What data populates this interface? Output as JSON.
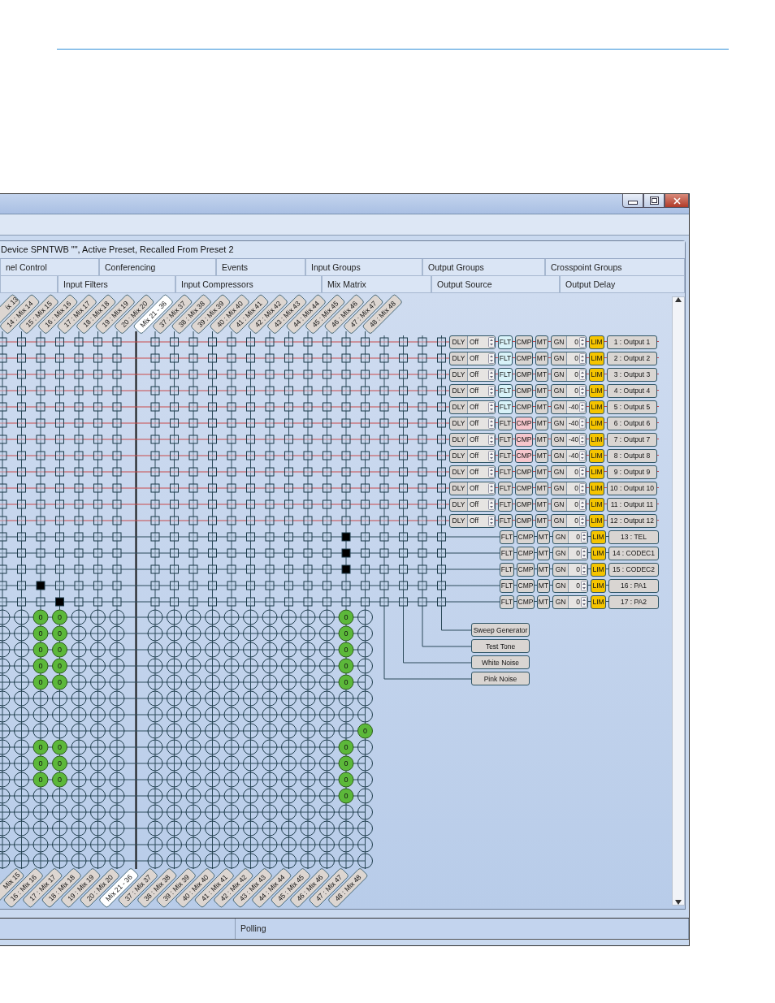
{
  "window": {
    "header": "Device SPNTWB \"\", Active Preset, Recalled From Preset 2"
  },
  "tabs_row_1": [
    {
      "label": "nel Control"
    },
    {
      "label": "Conferencing"
    },
    {
      "label": "Events"
    },
    {
      "label": "Input Groups"
    },
    {
      "label": "Output Groups"
    },
    {
      "label": "Crosspoint Groups"
    }
  ],
  "tabs_row_2": [
    {
      "label": "Input Filters"
    },
    {
      "label": "Input Compressors"
    },
    {
      "label": "Mix Matrix"
    },
    {
      "label": "Output Source"
    },
    {
      "label": "Output Delay"
    }
  ],
  "matrix": {
    "top_labels": [
      {
        "text": "ix 13",
        "kind": "partial"
      },
      {
        "text": "14 : Mix 14",
        "kind": "mix"
      },
      {
        "text": "15 : Mix 15",
        "kind": "mix"
      },
      {
        "text": "16 : Mix 16",
        "kind": "mix"
      },
      {
        "text": "17 : Mix 17",
        "kind": "mix"
      },
      {
        "text": "18 : Mix 18",
        "kind": "mix"
      },
      {
        "text": "19 : Mix 19",
        "kind": "mix"
      },
      {
        "text": "20 : Mix 20",
        "kind": "mix"
      },
      {
        "text": "Mix 21 - 36",
        "kind": "group"
      },
      {
        "text": "37 : Mix 37",
        "kind": "mix"
      },
      {
        "text": "38 : Mix 38",
        "kind": "mix"
      },
      {
        "text": "39 : Mix 39",
        "kind": "mix"
      },
      {
        "text": "40 : Mix 40",
        "kind": "mix"
      },
      {
        "text": "41 : Mix 41",
        "kind": "mix"
      },
      {
        "text": "42 : Mix 42",
        "kind": "mix"
      },
      {
        "text": "43 : Mix 43",
        "kind": "mix"
      },
      {
        "text": "44 : Mix 44",
        "kind": "mix"
      },
      {
        "text": "45 : Mix 45",
        "kind": "mix"
      },
      {
        "text": "46 : Mix 46",
        "kind": "mix"
      },
      {
        "text": "47 : Mix 47",
        "kind": "mix"
      },
      {
        "text": "48 : Mix 48",
        "kind": "mix"
      }
    ],
    "bottom_labels": [
      {
        "text": "Mix 15",
        "kind": "partial"
      },
      {
        "text": "16 : Mix 16",
        "kind": "mix"
      },
      {
        "text": "17 : Mix 17",
        "kind": "mix"
      },
      {
        "text": "18 : Mix 18",
        "kind": "mix"
      },
      {
        "text": "19 : Mix 19",
        "kind": "mix"
      },
      {
        "text": "20 : Mix 20",
        "kind": "mix"
      },
      {
        "text": "Mix 21 - 36",
        "kind": "group"
      },
      {
        "text": "37 : Mix 37",
        "kind": "mix"
      },
      {
        "text": "38 : Mix 38",
        "kind": "mix"
      },
      {
        "text": "39 : Mix 39",
        "kind": "mix"
      },
      {
        "text": "40 : Mix 40",
        "kind": "mix"
      },
      {
        "text": "41 : Mix 41",
        "kind": "mix"
      },
      {
        "text": "42 : Mix 42",
        "kind": "mix"
      },
      {
        "text": "43 : Mix 43",
        "kind": "mix"
      },
      {
        "text": "44 : Mix 44",
        "kind": "mix"
      },
      {
        "text": "45 : Mix 45",
        "kind": "mix"
      },
      {
        "text": "46 : Mix 46",
        "kind": "mix"
      },
      {
        "text": "47 : Mix 47",
        "kind": "mix"
      },
      {
        "text": "48 : Mix 48",
        "kind": "mix"
      }
    ],
    "columns": [
      {
        "kind": "mix"
      },
      {
        "kind": "mix"
      },
      {
        "kind": "mix"
      },
      {
        "kind": "mix"
      },
      {
        "kind": "mix"
      },
      {
        "kind": "mix"
      },
      {
        "kind": "mix"
      },
      {
        "kind": "group"
      },
      {
        "kind": "mix"
      },
      {
        "kind": "mix"
      },
      {
        "kind": "mix"
      },
      {
        "kind": "mix"
      },
      {
        "kind": "mix"
      },
      {
        "kind": "mix"
      },
      {
        "kind": "mix"
      },
      {
        "kind": "mix"
      },
      {
        "kind": "mix"
      },
      {
        "kind": "mix"
      },
      {
        "kind": "mix"
      },
      {
        "kind": "mix"
      },
      {
        "kind": "source"
      },
      {
        "kind": "source"
      },
      {
        "kind": "source"
      },
      {
        "kind": "source"
      }
    ],
    "rows": [
      {
        "name": "1 : Output 1",
        "delay": {
          "label": "DLY",
          "value": "Off"
        },
        "filter": {
          "label": "FLT",
          "on": true
        },
        "compressor": {
          "label": "CMP",
          "on": false
        },
        "mute": {
          "label": "MT"
        },
        "gain": {
          "label": "GN",
          "value": "0"
        },
        "limiter": {
          "label": "LIM"
        },
        "points": [
          false,
          false,
          false,
          false,
          false,
          false,
          false,
          false,
          false,
          false,
          false,
          false,
          false,
          false,
          false,
          false,
          false,
          false,
          false,
          false,
          false,
          false,
          false
        ]
      },
      {
        "name": "2 : Output 2",
        "delay": {
          "label": "DLY",
          "value": "Off"
        },
        "filter": {
          "label": "FLT",
          "on": true
        },
        "compressor": {
          "label": "CMP",
          "on": false
        },
        "mute": {
          "label": "MT"
        },
        "gain": {
          "label": "GN",
          "value": "0"
        },
        "limiter": {
          "label": "LIM"
        },
        "points": [
          false,
          false,
          false,
          false,
          false,
          false,
          false,
          false,
          false,
          false,
          false,
          false,
          false,
          false,
          false,
          false,
          false,
          false,
          false,
          false,
          false,
          false,
          false
        ]
      },
      {
        "name": "3 : Output 3",
        "delay": {
          "label": "DLY",
          "value": "Off"
        },
        "filter": {
          "label": "FLT",
          "on": true
        },
        "compressor": {
          "label": "CMP",
          "on": false
        },
        "mute": {
          "label": "MT"
        },
        "gain": {
          "label": "GN",
          "value": "0"
        },
        "limiter": {
          "label": "LIM"
        },
        "points": [
          false,
          false,
          false,
          false,
          false,
          false,
          false,
          false,
          false,
          false,
          false,
          false,
          false,
          false,
          false,
          false,
          false,
          false,
          false,
          false,
          false,
          false,
          false
        ]
      },
      {
        "name": "4 : Output 4",
        "delay": {
          "label": "DLY",
          "value": "Off"
        },
        "filter": {
          "label": "FLT",
          "on": true
        },
        "compressor": {
          "label": "CMP",
          "on": false
        },
        "mute": {
          "label": "MT"
        },
        "gain": {
          "label": "GN",
          "value": "0"
        },
        "limiter": {
          "label": "LIM"
        },
        "points": [
          false,
          false,
          false,
          false,
          false,
          false,
          false,
          false,
          false,
          false,
          false,
          false,
          false,
          false,
          false,
          false,
          false,
          false,
          false,
          false,
          false,
          false,
          false
        ]
      },
      {
        "name": "5 : Output 5",
        "delay": {
          "label": "DLY",
          "value": "Off"
        },
        "filter": {
          "label": "FLT",
          "on": true
        },
        "compressor": {
          "label": "CMP",
          "on": false
        },
        "mute": {
          "label": "MT"
        },
        "gain": {
          "label": "GN",
          "value": "-40"
        },
        "limiter": {
          "label": "LIM"
        },
        "points": [
          false,
          false,
          false,
          false,
          false,
          false,
          false,
          false,
          false,
          false,
          false,
          false,
          false,
          false,
          false,
          false,
          false,
          false,
          false,
          false,
          false,
          false,
          false
        ]
      },
      {
        "name": "6 : Output 6",
        "delay": {
          "label": "DLY",
          "value": "Off"
        },
        "filter": {
          "label": "FLT",
          "on": false
        },
        "compressor": {
          "label": "CMP",
          "on": true
        },
        "mute": {
          "label": "MT"
        },
        "gain": {
          "label": "GN",
          "value": "-40"
        },
        "limiter": {
          "label": "LIM"
        },
        "points": [
          false,
          false,
          false,
          false,
          false,
          false,
          false,
          false,
          false,
          false,
          false,
          false,
          false,
          false,
          false,
          false,
          false,
          false,
          false,
          false,
          false,
          false,
          false
        ]
      },
      {
        "name": "7 : Output 7",
        "delay": {
          "label": "DLY",
          "value": "Off"
        },
        "filter": {
          "label": "FLT",
          "on": false
        },
        "compressor": {
          "label": "CMP",
          "on": true
        },
        "mute": {
          "label": "MT"
        },
        "gain": {
          "label": "GN",
          "value": "-40"
        },
        "limiter": {
          "label": "LIM"
        },
        "points": [
          false,
          false,
          false,
          false,
          false,
          false,
          false,
          false,
          false,
          false,
          false,
          false,
          false,
          false,
          false,
          false,
          false,
          false,
          false,
          false,
          false,
          false,
          false
        ]
      },
      {
        "name": "8 : Output 8",
        "delay": {
          "label": "DLY",
          "value": "Off"
        },
        "filter": {
          "label": "FLT",
          "on": false
        },
        "compressor": {
          "label": "CMP",
          "on": true
        },
        "mute": {
          "label": "MT"
        },
        "gain": {
          "label": "GN",
          "value": "-40"
        },
        "limiter": {
          "label": "LIM"
        },
        "points": [
          false,
          false,
          false,
          false,
          false,
          false,
          false,
          false,
          false,
          false,
          false,
          false,
          false,
          false,
          false,
          false,
          false,
          false,
          false,
          false,
          false,
          false,
          false
        ]
      },
      {
        "name": "9 : Output 9",
        "delay": {
          "label": "DLY",
          "value": "Off"
        },
        "filter": {
          "label": "FLT",
          "on": false
        },
        "compressor": {
          "label": "CMP",
          "on": false
        },
        "mute": {
          "label": "MT"
        },
        "gain": {
          "label": "GN",
          "value": "0"
        },
        "limiter": {
          "label": "LIM"
        },
        "points": [
          false,
          false,
          false,
          false,
          false,
          false,
          false,
          false,
          false,
          false,
          false,
          false,
          false,
          false,
          false,
          false,
          false,
          false,
          false,
          false,
          false,
          false,
          false
        ]
      },
      {
        "name": "10 : Output 10",
        "delay": {
          "label": "DLY",
          "value": "Off"
        },
        "filter": {
          "label": "FLT",
          "on": false
        },
        "compressor": {
          "label": "CMP",
          "on": false
        },
        "mute": {
          "label": "MT"
        },
        "gain": {
          "label": "GN",
          "value": "0"
        },
        "limiter": {
          "label": "LIM"
        },
        "points": [
          false,
          false,
          false,
          false,
          false,
          false,
          false,
          false,
          false,
          false,
          false,
          false,
          false,
          false,
          false,
          false,
          false,
          false,
          false,
          false,
          false,
          false,
          false
        ]
      },
      {
        "name": "11 : Output 11",
        "delay": {
          "label": "DLY",
          "value": "Off"
        },
        "filter": {
          "label": "FLT",
          "on": false
        },
        "compressor": {
          "label": "CMP",
          "on": false
        },
        "mute": {
          "label": "MT"
        },
        "gain": {
          "label": "GN",
          "value": "0"
        },
        "limiter": {
          "label": "LIM"
        },
        "points": [
          false,
          false,
          false,
          false,
          false,
          false,
          false,
          false,
          false,
          false,
          false,
          false,
          false,
          false,
          false,
          false,
          false,
          false,
          false,
          false,
          false,
          false,
          false
        ]
      },
      {
        "name": "12 : Output 12",
        "delay": {
          "label": "DLY",
          "value": "Off"
        },
        "filter": {
          "label": "FLT",
          "on": false
        },
        "compressor": {
          "label": "CMP",
          "on": false
        },
        "mute": {
          "label": "MT"
        },
        "gain": {
          "label": "GN",
          "value": "0"
        },
        "limiter": {
          "label": "LIM"
        },
        "points": [
          false,
          false,
          false,
          false,
          false,
          false,
          false,
          false,
          false,
          false,
          false,
          false,
          false,
          false,
          false,
          false,
          false,
          false,
          false,
          false,
          false,
          false,
          false
        ]
      },
      {
        "name": "13 : TEL",
        "filter": {
          "label": "FLT",
          "on": false
        },
        "compressor": {
          "label": "CMP",
          "on": false
        },
        "mute": {
          "label": "MT"
        },
        "gain": {
          "label": "GN",
          "value": "0"
        },
        "limiter": {
          "label": "LIM"
        },
        "points": [
          false,
          false,
          false,
          false,
          false,
          false,
          false,
          false,
          false,
          false,
          false,
          false,
          false,
          false,
          false,
          false,
          false,
          true,
          false,
          false,
          false,
          false,
          false
        ]
      },
      {
        "name": "14 : CODEC1",
        "filter": {
          "label": "FLT",
          "on": false
        },
        "compressor": {
          "label": "CMP",
          "on": false
        },
        "mute": {
          "label": "MT"
        },
        "gain": {
          "label": "GN",
          "value": "0"
        },
        "limiter": {
          "label": "LIM"
        },
        "points": [
          false,
          false,
          false,
          false,
          false,
          false,
          false,
          false,
          false,
          false,
          false,
          false,
          false,
          false,
          false,
          false,
          false,
          true,
          false,
          false,
          false,
          false,
          false
        ]
      },
      {
        "name": "15 : CODEC2",
        "filter": {
          "label": "FLT",
          "on": false
        },
        "compressor": {
          "label": "CMP",
          "on": false
        },
        "mute": {
          "label": "MT"
        },
        "gain": {
          "label": "GN",
          "value": "0"
        },
        "limiter": {
          "label": "LIM"
        },
        "points": [
          false,
          false,
          false,
          false,
          false,
          false,
          false,
          false,
          false,
          false,
          false,
          false,
          false,
          false,
          false,
          false,
          false,
          true,
          false,
          false,
          false,
          false,
          false
        ]
      },
      {
        "name": "16 : PA1",
        "filter": {
          "label": "FLT",
          "on": false
        },
        "compressor": {
          "label": "CMP",
          "on": false
        },
        "mute": {
          "label": "MT"
        },
        "gain": {
          "label": "GN",
          "value": "0"
        },
        "limiter": {
          "label": "LIM"
        },
        "points": [
          false,
          false,
          true,
          false,
          false,
          false,
          false,
          false,
          false,
          false,
          false,
          false,
          false,
          false,
          false,
          false,
          false,
          false,
          false,
          false,
          false,
          false,
          false
        ]
      },
      {
        "name": "17 : PA2",
        "filter": {
          "label": "FLT",
          "on": false
        },
        "compressor": {
          "label": "CMP",
          "on": false
        },
        "mute": {
          "label": "MT"
        },
        "gain": {
          "label": "GN",
          "value": "0"
        },
        "limiter": {
          "label": "LIM"
        },
        "points": [
          false,
          false,
          false,
          true,
          false,
          false,
          false,
          false,
          false,
          false,
          false,
          false,
          false,
          false,
          false,
          false,
          false,
          false,
          false,
          false,
          false,
          false,
          false
        ]
      }
    ],
    "mix_rows": [
      {
        "active": [
          false,
          false,
          true,
          true,
          false,
          false,
          false,
          false,
          false,
          false,
          false,
          false,
          false,
          false,
          false,
          false,
          false,
          true,
          false
        ],
        "values": [
          "0",
          "0",
          "0"
        ]
      },
      {
        "active": [
          false,
          false,
          true,
          true,
          false,
          false,
          false,
          false,
          false,
          false,
          false,
          false,
          false,
          false,
          false,
          false,
          false,
          true,
          false
        ],
        "values": [
          "0",
          "0",
          "0"
        ]
      },
      {
        "active": [
          false,
          false,
          true,
          true,
          false,
          false,
          false,
          false,
          false,
          false,
          false,
          false,
          false,
          false,
          false,
          false,
          false,
          true,
          false
        ],
        "values": [
          "0",
          "0",
          "0"
        ]
      },
      {
        "active": [
          false,
          false,
          true,
          true,
          false,
          false,
          false,
          false,
          false,
          false,
          false,
          false,
          false,
          false,
          false,
          false,
          false,
          true,
          false
        ],
        "values": [
          "0",
          "0",
          "0"
        ]
      },
      {
        "active": [
          false,
          false,
          true,
          true,
          false,
          false,
          false,
          false,
          false,
          false,
          false,
          false,
          false,
          false,
          false,
          false,
          false,
          true,
          false
        ],
        "values": [
          "0",
          "0",
          "0"
        ]
      },
      {
        "active": [
          false,
          false,
          false,
          false,
          false,
          false,
          false,
          false,
          false,
          false,
          false,
          false,
          false,
          false,
          false,
          false,
          false,
          false,
          false
        ]
      },
      {
        "active": [
          false,
          false,
          false,
          false,
          false,
          false,
          false,
          false,
          false,
          false,
          false,
          false,
          false,
          false,
          false,
          false,
          false,
          false,
          false
        ]
      },
      {
        "active": [
          false,
          false,
          false,
          false,
          false,
          false,
          false,
          false,
          false,
          false,
          false,
          false,
          false,
          false,
          false,
          false,
          false,
          false,
          true
        ],
        "values": [
          "0"
        ]
      },
      {
        "active": [
          false,
          false,
          true,
          true,
          false,
          false,
          false,
          false,
          false,
          false,
          false,
          false,
          false,
          false,
          false,
          false,
          false,
          true,
          false
        ],
        "values": [
          "0",
          "0",
          "0"
        ]
      },
      {
        "active": [
          false,
          false,
          true,
          true,
          false,
          false,
          false,
          false,
          false,
          false,
          false,
          false,
          false,
          false,
          false,
          false,
          false,
          true,
          false
        ],
        "values": [
          "0",
          "0",
          "0"
        ]
      },
      {
        "active": [
          false,
          false,
          true,
          true,
          false,
          false,
          false,
          false,
          false,
          false,
          false,
          false,
          false,
          false,
          false,
          false,
          false,
          true,
          false
        ],
        "values": [
          "0",
          "0",
          "0"
        ]
      },
      {
        "active": [
          false,
          false,
          false,
          false,
          false,
          false,
          false,
          false,
          false,
          false,
          false,
          false,
          false,
          false,
          false,
          false,
          false,
          true,
          false
        ],
        "values": [
          "0"
        ]
      },
      {
        "active": [
          false,
          false,
          false,
          false,
          false,
          false,
          false,
          false,
          false,
          false,
          false,
          false,
          false,
          false,
          false,
          false,
          false,
          false,
          false
        ]
      },
      {
        "active": [
          false,
          false,
          false,
          false,
          false,
          false,
          false,
          false,
          false,
          false,
          false,
          false,
          false,
          false,
          false,
          false,
          false,
          false,
          false
        ]
      },
      {
        "active": [
          false,
          false,
          false,
          false,
          false,
          false,
          false,
          false,
          false,
          false,
          false,
          false,
          false,
          false,
          false,
          false,
          false,
          false,
          false
        ]
      },
      {
        "active": [
          false,
          false,
          false,
          false,
          false,
          false,
          false,
          false,
          false,
          false,
          false,
          false,
          false,
          false,
          false,
          false,
          false,
          false,
          false
        ]
      }
    ],
    "sources": [
      {
        "label": "Sweep Generator"
      },
      {
        "label": "Test Tone"
      },
      {
        "label": "White Noise"
      },
      {
        "label": "Pink Noise"
      }
    ]
  },
  "status_bar": {
    "text": "Polling"
  }
}
